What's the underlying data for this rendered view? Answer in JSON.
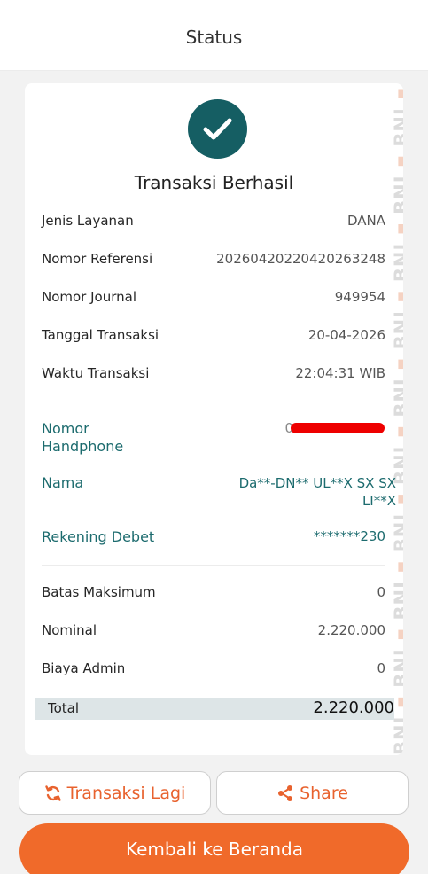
{
  "header": {
    "title": "Status"
  },
  "receipt": {
    "status_title": "Transaksi Berhasil",
    "watermark": "BNI",
    "details": [
      {
        "label": "Jenis Layanan",
        "value": "DANA"
      },
      {
        "label": "Nomor Referensi",
        "value": "20260420220420263248"
      },
      {
        "label": "Nomor Journal",
        "value": "949954"
      },
      {
        "label": "Tanggal Transaksi",
        "value": "20-04-2026"
      },
      {
        "label": "Waktu Transaksi",
        "value": "22:04:31 WIB"
      }
    ],
    "customer": {
      "phone_label_line1": "Nomor",
      "phone_label_line2": "Handphone",
      "phone_value_visible": "0",
      "name_label": "Nama",
      "name_value_line1": "Da**-DN** UL**X SX SX",
      "name_value_line2": "LI**X",
      "account_label": "Rekening Debet",
      "account_value": "*******230"
    },
    "amounts": [
      {
        "label": "Batas Maksimum",
        "value": "0"
      },
      {
        "label": "Nominal",
        "value": "2.220.000"
      },
      {
        "label": "Biaya Admin",
        "value": "0"
      }
    ],
    "total": {
      "label": "Total",
      "value": "2.220.000"
    }
  },
  "actions": {
    "retry_label": "Transaksi Lagi",
    "share_label": "Share",
    "home_label": "Kembali ke Beranda"
  },
  "colors": {
    "accent": "#f06a2a",
    "teal": "#155e63",
    "redaction": "#ee0000"
  }
}
